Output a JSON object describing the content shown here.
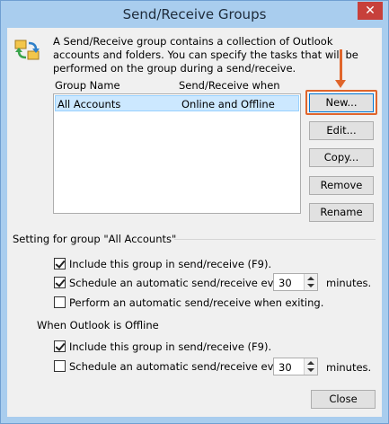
{
  "window": {
    "title": "Send/Receive Groups",
    "close_glyph": "✕"
  },
  "description": "A Send/Receive group contains a collection of Outlook accounts and folders. You can specify the tasks that will be performed on the group during a send/receive.",
  "list": {
    "columns": [
      "Group Name",
      "Send/Receive when"
    ],
    "rows": [
      {
        "name": "All Accounts",
        "when": "Online and Offline",
        "selected": true
      }
    ]
  },
  "buttons": {
    "new": "New...",
    "edit": "Edit...",
    "copy": "Copy...",
    "remove": "Remove",
    "rename": "Rename",
    "close": "Close"
  },
  "settings_group": {
    "label": "Setting for group \"All Accounts\"",
    "include": {
      "label": "Include this group in send/receive (F9).",
      "checked": true
    },
    "schedule": {
      "label": "Schedule an automatic send/receive every",
      "checked": true,
      "value": "30",
      "unit": "minutes."
    },
    "on_exit": {
      "label": "Perform an automatic send/receive when exiting.",
      "checked": false
    }
  },
  "offline_group": {
    "label": "When Outlook is Offline",
    "include": {
      "label": "Include this group in send/receive (F9).",
      "checked": true
    },
    "schedule": {
      "label": "Schedule an automatic send/receive every",
      "checked": false,
      "value": "30",
      "unit": "minutes."
    }
  },
  "annotation": {
    "color": "#e0652b"
  }
}
